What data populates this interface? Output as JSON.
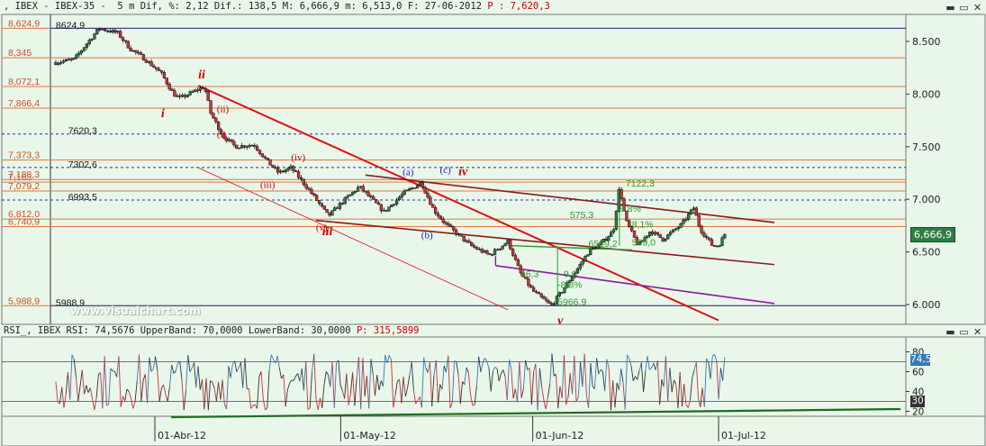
{
  "header": {
    "main_pre": ", IBEX - IBEX-35 -  5 m Dif, %: 2,12 Dif.: 138,5 M: 6,666,9 m: 6,513,0 F: 27-06-2012",
    "main_p": "P : 7,620,3",
    "rsi_pre": "RSI_, IBEX RSI: 74,5676 UpperBand: 70,0000 LowerBand: 30,0000",
    "rsi_p": "P: 315,5899"
  },
  "watermark": "www.visualchart.com",
  "window_buttons": {
    "minimize": "▬",
    "restore": "▭",
    "close": "✕"
  },
  "colors": {
    "background": "#e9f6ea",
    "bull_candle": "#2f7d43",
    "bear_candle": "#cc3333",
    "fib_line": "#e07a3a",
    "trend_red": "#e01010",
    "channel_brown": "#8b1a1a",
    "purple_line": "#8a1aa0",
    "green_line": "#2a9a2a",
    "rsi_bull": "#3a78b8",
    "rsi_bear": "#cc3333"
  },
  "chart_data": [
    {
      "type": "candlestick",
      "title": ", IBEX - IBEX-35 -  5 m Dif, %: 2,12 Dif.: 138,5 M: 6,666,9 m: 6,513,0 F: 27-06-2012 P : 7,620,3",
      "ylim": [
        5940,
        8680
      ],
      "y_ticks": [
        "8.500",
        "8.000",
        "7.500",
        "7.000",
        "6.500",
        "6.000"
      ],
      "y_tick_values": [
        8500,
        8000,
        7500,
        7000,
        6500,
        6000
      ],
      "x_tick_labels": [
        "01-Abr-12",
        "01-May-12",
        "01-Jun-12",
        "01-Jul-12"
      ],
      "x_tick_dates": [
        "2012-04-01",
        "2012-05-01",
        "2012-06-01",
        "2012-07-01"
      ],
      "last_price_label": "6,666,9",
      "path": [
        [
          "2012-03-16",
          8300
        ],
        [
          "2012-03-19",
          8330
        ],
        [
          "2012-03-21",
          8480
        ],
        [
          "2012-03-23",
          8624.9
        ],
        [
          "2012-03-26",
          8580
        ],
        [
          "2012-03-28",
          8430
        ],
        [
          "2012-03-30",
          8350
        ],
        [
          "2012-04-02",
          8200
        ],
        [
          "2012-04-04",
          8000
        ],
        [
          "2012-04-05",
          7960
        ],
        [
          "2012-04-09",
          8072
        ],
        [
          "2012-04-10",
          7820
        ],
        [
          "2012-04-12",
          7600
        ],
        [
          "2012-04-14",
          7500
        ],
        [
          "2012-04-17",
          7520
        ],
        [
          "2012-04-19",
          7370
        ],
        [
          "2012-04-21",
          7250
        ],
        [
          "2012-04-23",
          7300
        ],
        [
          "2012-04-26",
          7080
        ],
        [
          "2012-04-29",
          6840
        ],
        [
          "2012-05-01",
          6960
        ],
        [
          "2012-05-04",
          7120
        ],
        [
          "2012-05-08",
          6880
        ],
        [
          "2012-05-11",
          7050
        ],
        [
          "2012-05-14",
          7160
        ],
        [
          "2012-05-16",
          6900
        ],
        [
          "2012-05-18",
          6760
        ],
        [
          "2012-05-22",
          6560
        ],
        [
          "2012-05-25",
          6470
        ],
        [
          "2012-05-28",
          6600
        ],
        [
          "2012-05-30",
          6300
        ],
        [
          "2012-06-01",
          6130
        ],
        [
          "2012-06-04",
          5988.9
        ],
        [
          "2012-06-06",
          6150
        ],
        [
          "2012-06-08",
          6320
        ],
        [
          "2012-06-10",
          6500
        ],
        [
          "2012-06-12",
          6580
        ],
        [
          "2012-06-14",
          6700
        ],
        [
          "2012-06-15",
          7122.3
        ],
        [
          "2012-06-16",
          6800
        ],
        [
          "2012-06-18",
          6560
        ],
        [
          "2012-06-20",
          6700
        ],
        [
          "2012-06-22",
          6620
        ],
        [
          "2012-06-25",
          6760
        ],
        [
          "2012-06-27",
          6920
        ],
        [
          "2012-06-28",
          6720
        ],
        [
          "2012-06-30",
          6560
        ],
        [
          "2012-07-01",
          6560
        ],
        [
          "2012-07-02",
          6666.9
        ]
      ],
      "horizontal_levels": [
        {
          "value": 8624.9,
          "label": "8,624,9",
          "style": "fib"
        },
        {
          "value": 8345,
          "label": "8,345",
          "style": "fib"
        },
        {
          "value": 8072.1,
          "label": "8,072,1",
          "style": "fib"
        },
        {
          "value": 7866.4,
          "label": "7,866,4",
          "style": "fib"
        },
        {
          "value": 7620.3,
          "label": "7620,3",
          "style": "dashed"
        },
        {
          "value": 7373.3,
          "label": "7,373,3",
          "style": "fib"
        },
        {
          "value": 7302.6,
          "label": "7302,6",
          "style": "dashed"
        },
        {
          "value": 7188.3,
          "label": "7,188,3",
          "style": "fib"
        },
        {
          "value": 7163,
          "label": "7,163",
          "style": "fib"
        },
        {
          "value": 7079.2,
          "label": "7,079,2",
          "style": "fib"
        },
        {
          "value": 6993.5,
          "label": "6993,5",
          "style": "dashed"
        },
        {
          "value": 6812.0,
          "label": "6,812,0",
          "style": "fib"
        },
        {
          "value": 6740.9,
          "label": "6,740,9",
          "style": "fib"
        },
        {
          "value": 5988.9,
          "label": "5,988,9",
          "style": "fib"
        }
      ],
      "inner_labels": [
        {
          "text": "8624,9",
          "date": "2012-03-16",
          "value": 8624.9,
          "color": "#111"
        },
        {
          "text": "7620,3",
          "date": "2012-03-18",
          "value": 7620.3,
          "color": "#111"
        },
        {
          "text": "7302,6",
          "date": "2012-03-18",
          "value": 7302.6,
          "color": "#111"
        },
        {
          "text": "6993,5",
          "date": "2012-03-18",
          "value": 6993.5,
          "color": "#111"
        },
        {
          "text": "5988,9",
          "date": "2012-03-16",
          "value": 5988.9,
          "color": "#111"
        },
        {
          "text": "7122,3",
          "date": "2012-06-16",
          "value": 7122.3,
          "color": "#2a9a2a"
        },
        {
          "text": "575,3",
          "date": "2012-06-07",
          "value": 6820,
          "color": "#2a9a2a"
        },
        {
          "text": "8,8%",
          "date": "2012-06-15",
          "value": 6880,
          "color": "#2a9a2a"
        },
        {
          "text": "8,1%",
          "date": "2012-06-17",
          "value": 6730,
          "color": "#2a9a2a"
        },
        {
          "text": "6589,2",
          "date": "2012-06-10",
          "value": 6550,
          "color": "#2a9a2a"
        },
        {
          "text": "509,0",
          "date": "2012-06-17",
          "value": 6560,
          "color": "#2a9a2a"
        },
        {
          "text": "5966,9",
          "date": "2012-06-05",
          "value": 5995,
          "color": "#2a9a2a"
        },
        {
          "text": "-8,8%",
          "date": "2012-06-05",
          "value": 6160,
          "color": "#2a9a2a"
        },
        {
          "text": "9,0",
          "date": "2012-06-06",
          "value": 6260,
          "color": "#2a9a2a"
        },
        {
          "text": "56,3",
          "date": "2012-05-30",
          "value": 6260,
          "color": "#2a9a2a"
        }
      ],
      "wave_labels": [
        {
          "text": "i",
          "date": "2012-04-02",
          "value": 7780,
          "color": "#d00000",
          "bold": true,
          "italic": true
        },
        {
          "text": "ii",
          "date": "2012-04-08",
          "value": 8150,
          "color": "#d00000",
          "bold": true,
          "italic": true
        },
        {
          "text": "(ii)",
          "date": "2012-04-11",
          "value": 7830,
          "color": "#d00000"
        },
        {
          "text": "(i)",
          "date": "2012-04-11",
          "value": 7590,
          "color": "#d00000"
        },
        {
          "text": "(iv)",
          "date": "2012-04-23",
          "value": 7370,
          "color": "#d00000"
        },
        {
          "text": "(iii)",
          "date": "2012-04-18",
          "value": 7110,
          "color": "#d00000"
        },
        {
          "text": "(v)",
          "date": "2012-04-27",
          "value": 6700,
          "color": "#d00000"
        },
        {
          "text": "iii",
          "date": "2012-04-28",
          "value": 6660,
          "color": "#d00000",
          "bold": true,
          "italic": true
        },
        {
          "text": "(a)",
          "date": "2012-05-11",
          "value": 7230,
          "color": "#1a1acc"
        },
        {
          "text": "(b)",
          "date": "2012-05-14",
          "value": 6630,
          "color": "#1a1acc"
        },
        {
          "text": "(c)",
          "date": "2012-05-17",
          "value": 7250,
          "color": "#1a1acc"
        },
        {
          "text": "iv",
          "date": "2012-05-20",
          "value": 7230,
          "color": "#d00000",
          "bold": true,
          "italic": true
        },
        {
          "text": "v",
          "date": "2012-06-05",
          "value": 5810,
          "color": "#d00000",
          "bold": true,
          "italic": true
        }
      ]
    },
    {
      "type": "line",
      "title": "RSI_, IBEX RSI: 74,5676 UpperBand: 70,0000 LowerBand: 30,0000 P: 315,5899",
      "ylim": [
        15,
        95
      ],
      "y_ticks": [
        "80",
        "60",
        "40",
        "20"
      ],
      "y_tick_values": [
        80,
        60,
        40,
        20
      ],
      "upper_band": 70,
      "lower_band": 30,
      "current_value": 74.57,
      "current_value_label": "74,57",
      "lower_band_label": "30",
      "x_range": [
        "2012-03-16",
        "2012-07-02"
      ]
    }
  ]
}
